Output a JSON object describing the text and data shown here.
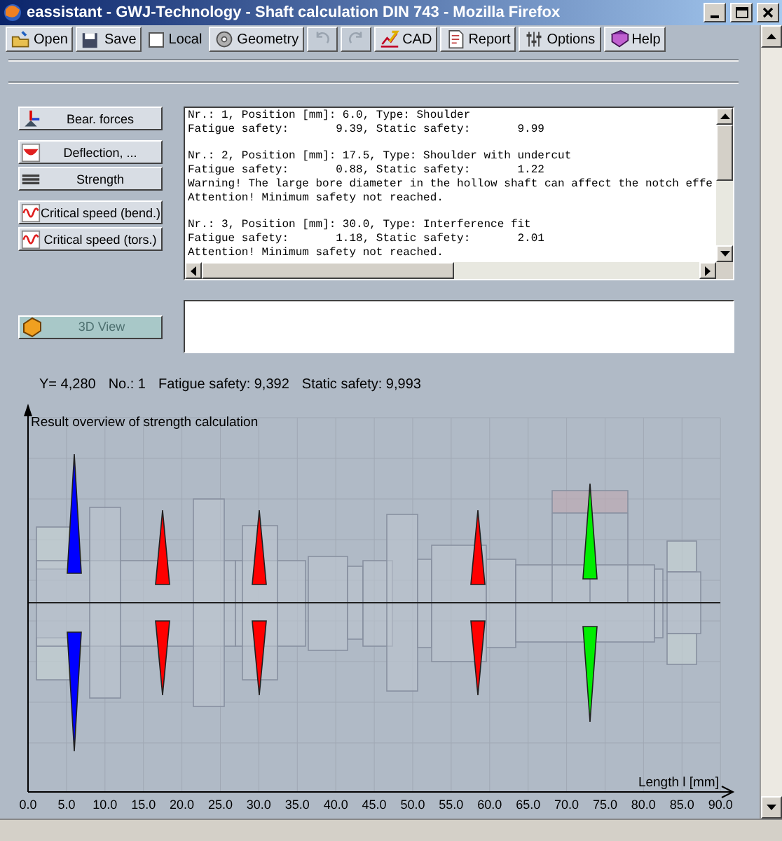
{
  "window": {
    "title": "eassistant - GWJ-Technology - Shaft calculation DIN 743 - Mozilla Firefox"
  },
  "toolbar": [
    {
      "kind": "button",
      "label": "Open",
      "disabled": false
    },
    {
      "kind": "button",
      "label": "Save",
      "disabled": false
    },
    {
      "kind": "checkbox",
      "label": "Local",
      "checked": false
    },
    {
      "kind": "button",
      "label": "Geometry",
      "disabled": false
    },
    {
      "kind": "undo",
      "disabled": true
    },
    {
      "kind": "redo",
      "disabled": true
    },
    {
      "kind": "button",
      "label": "CAD",
      "disabled": false
    },
    {
      "kind": "button",
      "label": "Report",
      "disabled": false
    },
    {
      "kind": "button",
      "label": "Options",
      "disabled": false
    },
    {
      "kind": "button",
      "label": "Help",
      "disabled": false
    }
  ],
  "side_groups": [
    {
      "buttons": [
        "Bear. forces"
      ]
    },
    {
      "buttons": [
        "Deflection, ...",
        "Strength"
      ]
    },
    {
      "buttons": [
        "Critical speed (bend.)",
        "Critical speed (tors.)"
      ]
    }
  ],
  "results": [
    {
      "lines": [
        "Nr.: 1, Position [mm]: 6.0, Type: Shoulder",
        "Fatigue safety:       9.39, Static safety:       9.99"
      ]
    },
    {
      "lines": [
        "Nr.: 2, Position [mm]: 17.5, Type: Shoulder with undercut",
        "Fatigue safety:       0.88, Static safety:       1.22",
        "Warning! The large bore diameter in the hollow shaft can affect the notch effe",
        "Attention! Minimum safety not reached."
      ]
    },
    {
      "lines": [
        "Nr.: 3, Position [mm]: 30.0, Type: Interference fit",
        "Fatigue safety:       1.18, Static safety:       2.01",
        "Attention! Minimum safety not reached."
      ]
    }
  ],
  "view_3d": {
    "label": "3D View",
    "disabled": true
  },
  "status": [
    "Y= 4,280",
    "No.: 1",
    "Fatigue safety: 9,392",
    "Static safety: 9,993"
  ],
  "plot": {
    "title": "Result overview of strength calculation",
    "xlabel": "Length l [mm]",
    "xticks": [
      "0.0",
      "5.0",
      "10.0",
      "15.0",
      "20.0",
      "25.0",
      "30.0",
      "35.0",
      "40.0",
      "45.0",
      "50.0",
      "55.0",
      "60.0",
      "65.0",
      "70.0",
      "75.0",
      "80.0",
      "85.0",
      "90.0"
    ]
  }
}
